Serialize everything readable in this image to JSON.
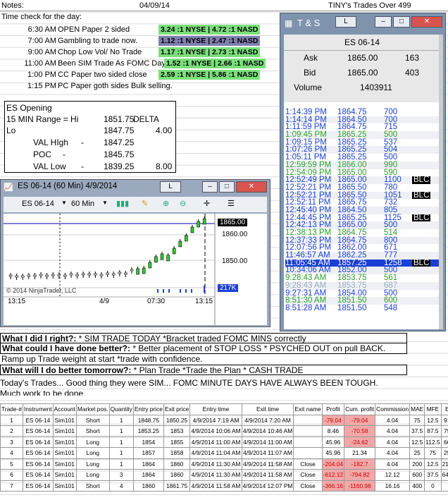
{
  "header": {
    "notes_label": "Notes:",
    "date": "04/09/14",
    "title": "TINY's Trades Over 499"
  },
  "timecheck": {
    "title": "Time check for the day:",
    "rows": [
      {
        "time": "6:30 AM",
        "desc": "OPEN Paper 2 sided",
        "ratio": "3.24 :1 NYSE | 4.72 :1 NASD",
        "bg": "#7be07b"
      },
      {
        "time": "7:00 AM",
        "desc": "Gambling to trade now.",
        "ratio": "1.12 :1 NYSE | 2.47 :1 NASD",
        "bg": "#7f7fb0"
      },
      {
        "time": "9:00 AM",
        "desc": "Chop Low Vol/ No Trade",
        "ratio": "1.17 :1 NYSE | 2.73 :1 NASD",
        "bg": "#7be07b"
      },
      {
        "time": "11:00 AM",
        "desc": "Been SIM Trade As FOMC Day",
        "ratio": "1.52 :1 NYSE | 2.66 :1 NASD",
        "bg": "#7be07b"
      },
      {
        "time": "1:00 PM",
        "desc": "CC Paper two sided close",
        "ratio": "2.59 :1 NYSE | 5.86 :1 NASD",
        "bg": "#7be07b"
      },
      {
        "time": "1:15 PM",
        "desc": "PC Paper goth sides Bulk selling.",
        "ratio": "",
        "bg": ""
      }
    ]
  },
  "es_box": {
    "title": "ES Opening",
    "range_label": "15 MIN Range = Hi",
    "hi": "1851.75",
    "delta": "DELTA",
    "lo_label": "Lo",
    "lo": "1847.75",
    "delta_val": "4.00",
    "val_high_label": "VAL HIgh",
    "val_high": "1847.25",
    "poc_label": "POC",
    "poc": "1845.75",
    "val_low_label": "VAL Low",
    "val_low": "1839.25",
    "val_low_delta": "8.00"
  },
  "ts": {
    "title": "T & S",
    "instrument": "ES 06-14",
    "ask_label": "Ask",
    "ask": "1865.00",
    "ask_size": "163",
    "bid_label": "Bid",
    "bid": "1865.00",
    "bid_size": "403",
    "volume_label": "Volume",
    "volume": "1403911",
    "rows": [
      {
        "t": "1:14:39 PM",
        "p": "1864.75",
        "s": "700",
        "c": "#1a3fd6",
        "tag": ""
      },
      {
        "t": "1:14:14 PM",
        "p": "1864.50",
        "s": "700",
        "c": "#1a3fd6",
        "tag": ""
      },
      {
        "t": "1:11:59 PM",
        "p": "1864.75",
        "s": "715",
        "c": "#1a3fd6",
        "tag": ""
      },
      {
        "t": "1:09:45 PM",
        "p": "1865.25",
        "s": "500",
        "c": "#2aa02a",
        "tag": ""
      },
      {
        "t": "1:09:15 PM",
        "p": "1865.25",
        "s": "537",
        "c": "#1a3fd6",
        "tag": ""
      },
      {
        "t": "1:07:26 PM",
        "p": "1865.25",
        "s": "504",
        "c": "#1a3fd6",
        "tag": ""
      },
      {
        "t": "1:05:11 PM",
        "p": "1865.25",
        "s": "500",
        "c": "#1a3fd6",
        "tag": ""
      },
      {
        "t": "12:59:59 PM",
        "p": "1866.00",
        "s": "990",
        "c": "#2aa02a",
        "tag": ""
      },
      {
        "t": "12:54:09 PM",
        "p": "1865.00",
        "s": "590",
        "c": "#2aa02a",
        "tag": ""
      },
      {
        "t": "12:52:49 PM",
        "p": "1865.00",
        "s": "1100",
        "c": "#1a3fd6",
        "tag": "BLC"
      },
      {
        "t": "12:52:21 PM",
        "p": "1865.50",
        "s": "780",
        "c": "#1a3fd6",
        "tag": ""
      },
      {
        "t": "12:52:21 PM",
        "p": "1865.50",
        "s": "1051",
        "c": "#1a3fd6",
        "tag": "BLC"
      },
      {
        "t": "12:52:11 PM",
        "p": "1865.75",
        "s": "732",
        "c": "#1a3fd6",
        "tag": ""
      },
      {
        "t": "12:45:40 PM",
        "p": "1864.50",
        "s": "805",
        "c": "#1a3fd6",
        "tag": ""
      },
      {
        "t": "12:44:45 PM",
        "p": "1865.25",
        "s": "1125",
        "c": "#1a3fd6",
        "tag": "BLC"
      },
      {
        "t": "12:42:13 PM",
        "p": "1865.00",
        "s": "500",
        "c": "#1a3fd6",
        "tag": ""
      },
      {
        "t": "12:38:13 PM",
        "p": "1864.75",
        "s": "514",
        "c": "#2aa02a",
        "tag": ""
      },
      {
        "t": "12:37:33 PM",
        "p": "1864.75",
        "s": "800",
        "c": "#1a3fd6",
        "tag": ""
      },
      {
        "t": "12:07:56 PM",
        "p": "1862.00",
        "s": "671",
        "c": "#1a3fd6",
        "tag": ""
      },
      {
        "t": "11:46:57 AM",
        "p": "1862.25",
        "s": "777",
        "c": "#1a3fd6",
        "tag": ""
      },
      {
        "t": "11:05:45 AM",
        "p": "1857.25",
        "s": "1258",
        "c": "#fff",
        "tag": "BLC",
        "hl": "#1a3fd6"
      },
      {
        "t": "10:34:06 AM",
        "p": "1852.00",
        "s": "500",
        "c": "#1a3fd6",
        "tag": ""
      },
      {
        "t": "9:28:43 AM",
        "p": "1853.75",
        "s": "561",
        "c": "#2aa02a",
        "tag": ""
      },
      {
        "t": "9:28:43 AM",
        "p": "1853.75",
        "s": "687",
        "c": "#9ab",
        "tag": ""
      },
      {
        "t": "9:27:31 AM",
        "p": "1854.00",
        "s": "500",
        "c": "#1a3fd6",
        "tag": ""
      },
      {
        "t": "8:51:30 AM",
        "p": "1851.50",
        "s": "600",
        "c": "#2aa02a",
        "tag": ""
      },
      {
        "t": "8:51:28 AM",
        "p": "1851.50",
        "s": "548",
        "c": "#1a3fd6",
        "tag": ""
      }
    ]
  },
  "chart": {
    "title": "ES 06-14 (60 Min)  4/9/2014",
    "instrument": "ES 06-14",
    "interval": "60 Min",
    "copyright": "© 2014 NinjaTrader, LLC",
    "price_labels": [
      "1865.00",
      "1860.00",
      "1850.00"
    ],
    "vol_label": "217K",
    "x_labels": [
      "13:15",
      "4/9",
      "07:30",
      "13:15"
    ]
  },
  "notes": {
    "l1_q": "What I did I right?:",
    "l1_a": " * SIM TRADE TODAY *Bracket traded FOMC MINS correctly",
    "l2_q": "What could I have done better?:",
    "l2_a": " * Better placement of STOP LOSS * PSYCHED OUT on pull BACK.",
    "l3": "Ramp up Trade weight at start *trade with confidence.",
    "l4_q": "What will I do better tomorrow?:",
    "l4_a": " * Plan Trade *Trade the Plan * CASH TRADE",
    "l5": "Today's Trades... Good thing they were SIM... FOMC MINUTE DAYS HAVE ALWAYS BEEN TOUGH.",
    "l6": "Much work to be done."
  },
  "trades": {
    "headers": [
      "Trade-#",
      "Instrument",
      "Account",
      "Market pos.",
      "Quantity",
      "Entry price",
      "Exit price",
      "Entry time",
      "Exit time",
      "Exit name",
      "Profit",
      "Cum. profit",
      "Commission",
      "MAE",
      "MFE",
      "ETD"
    ],
    "rows": [
      [
        "1",
        "ES 06-14",
        "Sim101",
        "Short",
        "1",
        "1848.75",
        "1850.25",
        "4/9/2014 7:19 AM",
        "4/9/2014 7:20 AM",
        "",
        "-79.04",
        "-79.04",
        "4.04",
        "75",
        "12.5",
        "91.54"
      ],
      [
        "2",
        "ES 06-14",
        "Sim101",
        "Short",
        "1",
        "1853.25",
        "1853",
        "4/9/2014 10:06 AM",
        "4/9/2014 10:46 AM",
        "",
        "8.46",
        "-70.58",
        "4.04",
        "37.5",
        "87.5",
        "79.04"
      ],
      [
        "3",
        "ES 06-14",
        "Sim101",
        "Long",
        "1",
        "1854",
        "1855",
        "4/9/2014 11:00 AM",
        "4/9/2014 11:00 AM",
        "",
        "45.96",
        "-24.62",
        "4.04",
        "12.5",
        "112.5",
        "66.54"
      ],
      [
        "4",
        "ES 06-14",
        "Sim101",
        "Long",
        "1",
        "1857",
        "1858",
        "4/9/2014 11:04 AM",
        "4/9/2014 11:07 AM",
        "",
        "45.96",
        "21.34",
        "4.04",
        "25",
        "75",
        "29.04"
      ],
      [
        "5",
        "ES 06-14",
        "Sim101",
        "Long",
        "1",
        "1864",
        "1860",
        "4/9/2014 11:30 AM",
        "4/9/2014 11:58 AM",
        "Close",
        "-204.04",
        "-182.7",
        "4.04",
        "200",
        "12.5",
        "216.54"
      ],
      [
        "6",
        "ES 06-14",
        "Sim101",
        "Long",
        "3",
        "1864",
        "1860",
        "4/9/2014 11:30 AM",
        "4/9/2014 11:58 AM",
        "Close",
        "-612.12",
        "-794.82",
        "12.12",
        "600",
        "37.5",
        "649.62"
      ],
      [
        "7",
        "ES 06-14",
        "Sim101",
        "Short",
        "4",
        "1860",
        "1861.75",
        "4/9/2014 11:58 AM",
        "4/9/2014 12:07 PM",
        "Close",
        "-366.16",
        "-1160.98",
        "16.16",
        "400",
        "0",
        "0"
      ]
    ]
  }
}
